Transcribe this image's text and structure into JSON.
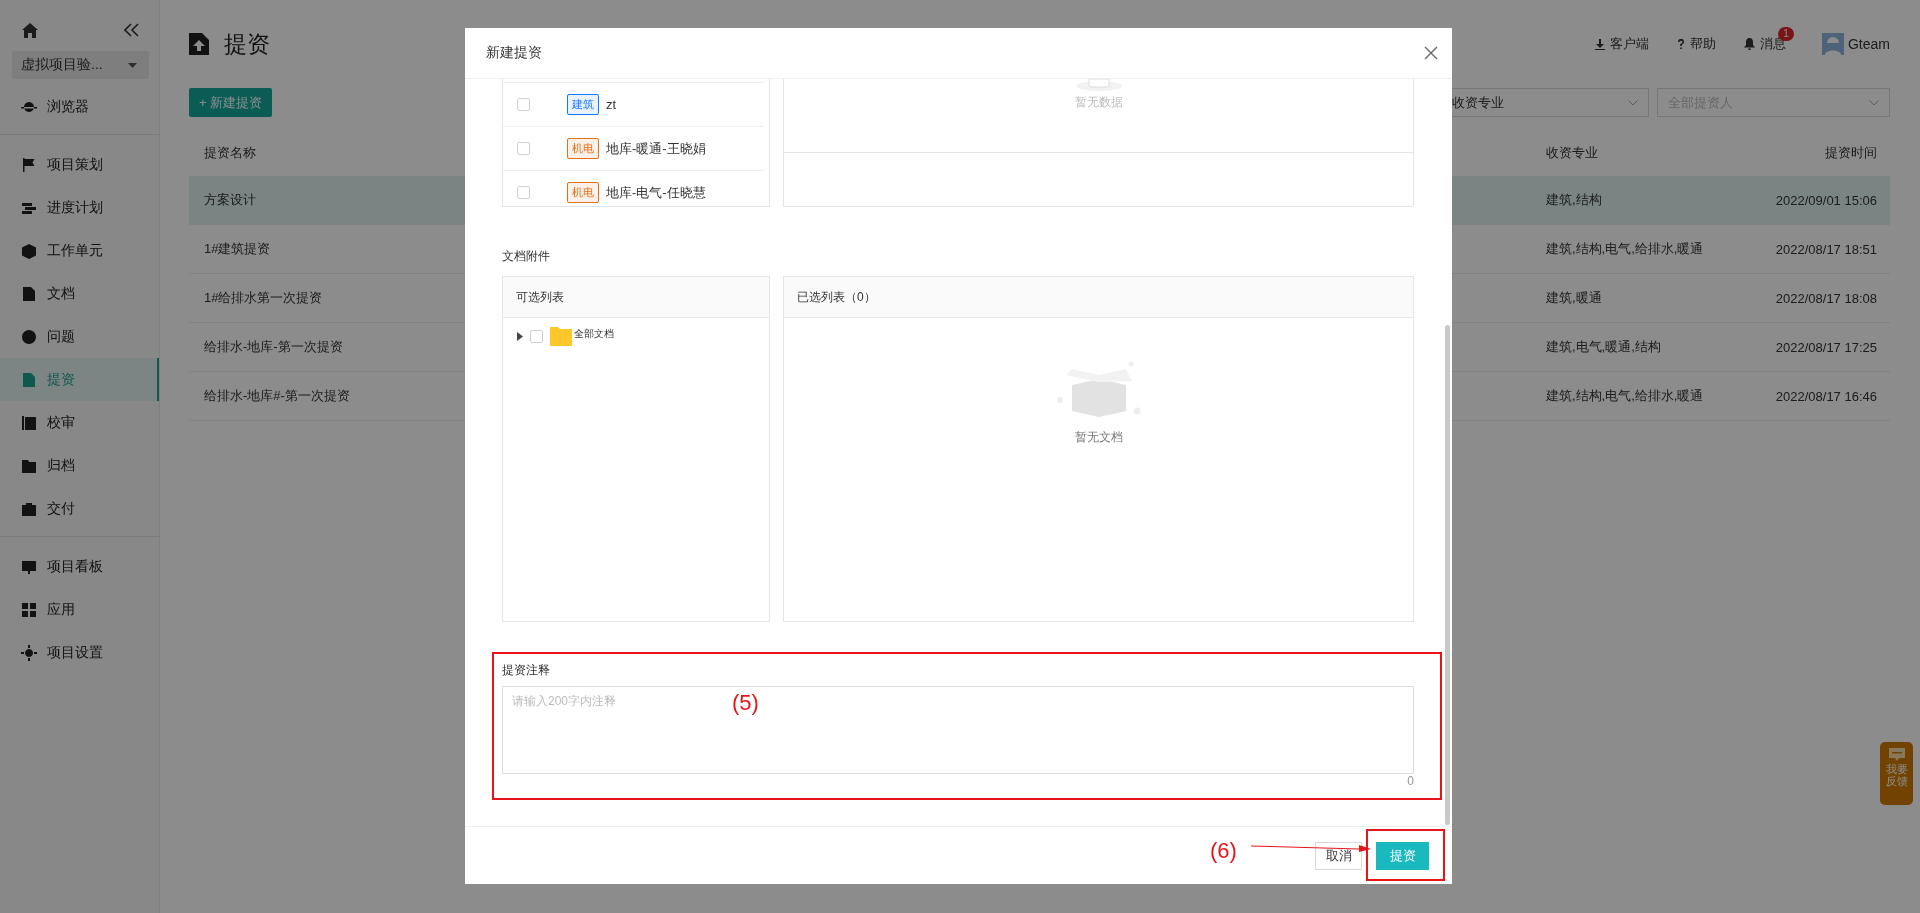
{
  "sidebar": {
    "project_select": "虚拟项目验...",
    "menu_groups": [
      {
        "items": [
          {
            "label": "浏览器",
            "selected": false
          }
        ]
      },
      {
        "items": [
          {
            "label": "项目策划",
            "selected": false
          },
          {
            "label": "进度计划",
            "selected": false
          },
          {
            "label": "工作单元",
            "selected": false
          },
          {
            "label": "文档",
            "selected": false
          },
          {
            "label": "问题",
            "selected": false
          },
          {
            "label": "提资",
            "selected": true
          },
          {
            "label": "校审",
            "selected": false
          },
          {
            "label": "归档",
            "selected": false
          },
          {
            "label": "交付",
            "selected": false
          }
        ]
      },
      {
        "items": [
          {
            "label": "项目看板",
            "selected": false
          },
          {
            "label": "应用",
            "selected": false
          },
          {
            "label": "项目设置",
            "selected": false
          }
        ]
      }
    ]
  },
  "header": {
    "title": "提资",
    "links": [
      "客户端",
      "帮助",
      "消息"
    ],
    "message_badge": "1",
    "user": "Gteam"
  },
  "toolbar": {
    "new_button": "+ 新建提资",
    "filters": [
      {
        "value": "收资专业"
      },
      {
        "placeholder": "全部提资人"
      }
    ]
  },
  "table": {
    "columns": [
      "提资名称",
      "收资专业",
      "提资时间"
    ],
    "rows": [
      {
        "name": "方案设计",
        "disciplines": "建筑,结构",
        "time": "2022/09/01 15:06",
        "selected": true
      },
      {
        "name": "1#建筑提资",
        "disciplines": "建筑,结构,电气,给排水,暖通",
        "time": "2022/08/17 18:51",
        "selected": false
      },
      {
        "name": "1#给排水第一次提资",
        "disciplines": "建筑,暖通",
        "time": "2022/08/17 18:08",
        "selected": false
      },
      {
        "name": "给排水-地库-第一次提资",
        "disciplines": "建筑,电气,暖通,结构",
        "time": "2022/08/17 17:25",
        "selected": false
      },
      {
        "name": "给排水-地库#-第一次提资",
        "disciplines": "建筑,结构,电气,给排水,暖通",
        "time": "2022/08/17 16:46",
        "selected": false
      }
    ]
  },
  "feedback_button": "我要反馈",
  "modal": {
    "title": "新建提资",
    "members": [
      {
        "tag": "建筑",
        "color": "#1677ff",
        "name": "zt",
        "checked": false
      },
      {
        "tag": "机电",
        "color": "#e0701a",
        "name": "地库-暖通-王晓娟",
        "checked": false
      },
      {
        "tag": "机电",
        "color": "#e0701a",
        "name": "地库-电气-任晓慧",
        "checked": false
      }
    ],
    "selected_members_empty": "暂无数据",
    "attachments": {
      "label": "文档附件",
      "available_header": "可选列表",
      "selected_header": "已选列表（0）",
      "tree": [
        {
          "label": "全部文档",
          "expanded": false,
          "checked": false
        }
      ],
      "empty": "暂无文档"
    },
    "note": {
      "label": "提资注释",
      "placeholder": "请输入200字内注释",
      "counter": "0"
    },
    "buttons": {
      "cancel": "取消",
      "submit": "提资"
    },
    "annotations": [
      "(5)",
      "(6)"
    ]
  }
}
